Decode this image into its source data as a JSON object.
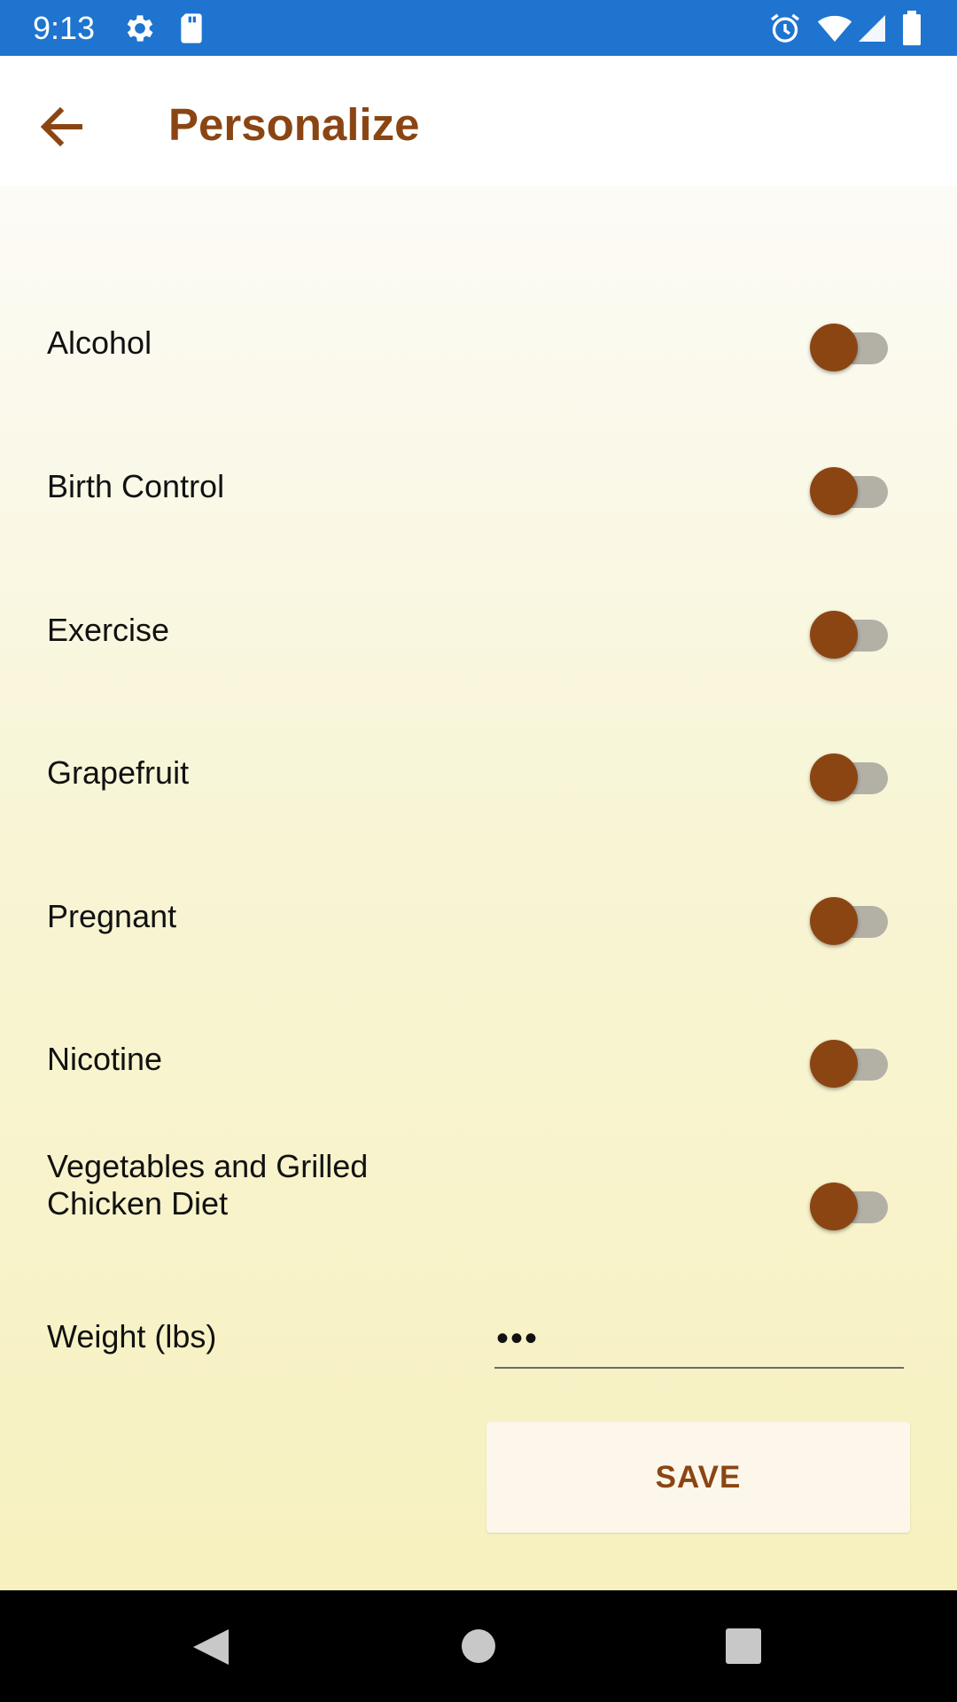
{
  "status_bar": {
    "time": "9:13",
    "left_icons": [
      "gear-icon",
      "sd-card-icon"
    ],
    "right_icons": [
      "alarm-icon",
      "wifi-icon",
      "signal-icon",
      "battery-icon"
    ],
    "color": "#1e74cf"
  },
  "app_bar": {
    "title": "Personalize",
    "back_icon": "arrow-left-icon",
    "accent_color": "#8b4513"
  },
  "settings": [
    {
      "label": "Alcohol",
      "enabled": false
    },
    {
      "label": "Birth Control",
      "enabled": false
    },
    {
      "label": "Exercise",
      "enabled": false
    },
    {
      "label": "Grapefruit",
      "enabled": false
    },
    {
      "label": "Pregnant",
      "enabled": false
    },
    {
      "label": "Nicotine",
      "enabled": false
    },
    {
      "label": "Vegetables and Grilled\nChicken Diet",
      "enabled": false
    }
  ],
  "weight": {
    "label": "Weight (lbs)",
    "value": "•••"
  },
  "save_button": {
    "label": "SAVE"
  },
  "nav_bar": {
    "icons": [
      "back-triangle-icon",
      "home-circle-icon",
      "recents-square-icon"
    ]
  }
}
